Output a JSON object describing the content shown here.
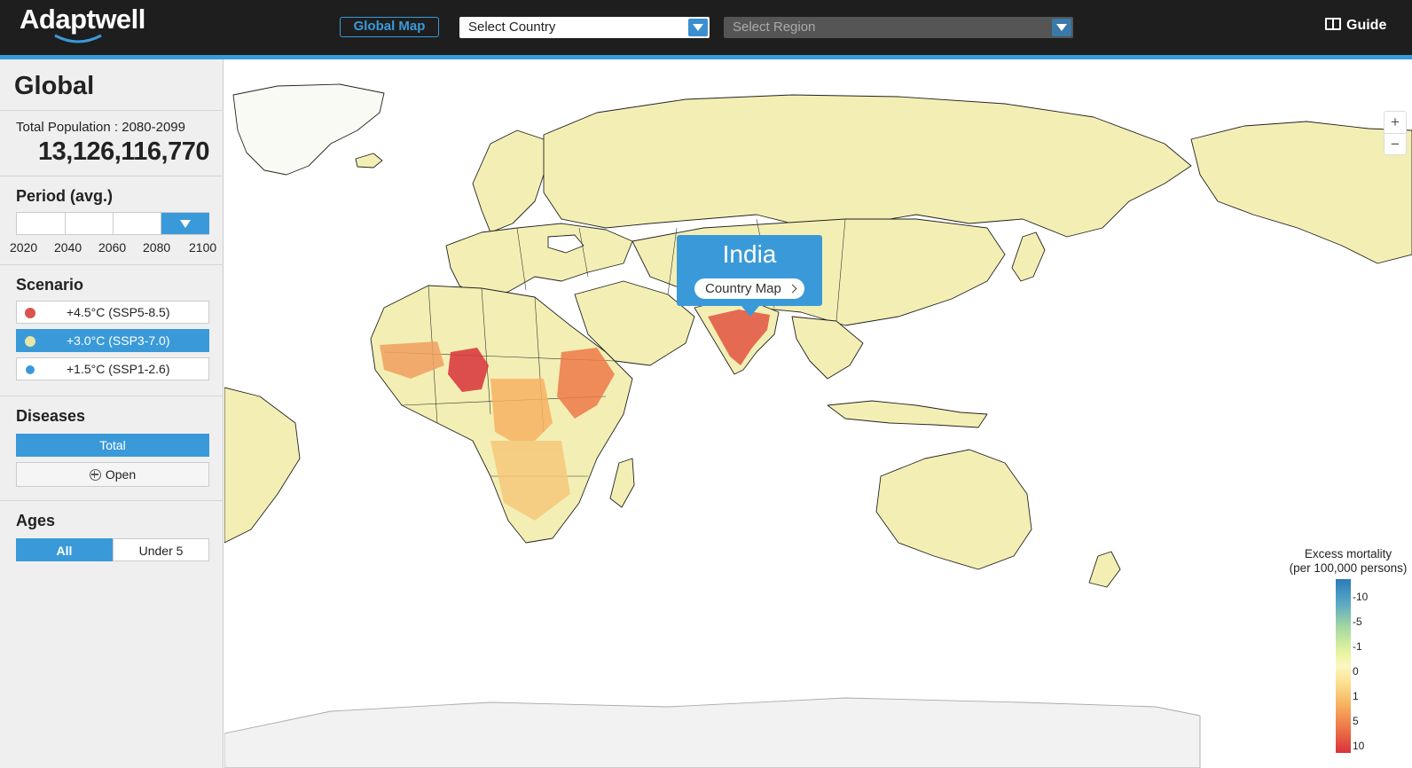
{
  "header": {
    "logo": "Adaptwell",
    "global_map_label": "Global Map",
    "country_select": {
      "value": "Select Country"
    },
    "region_select": {
      "value": "Select Region"
    },
    "guide_label": "Guide"
  },
  "sidebar": {
    "title": "Global",
    "population": {
      "label": "Total Population : 2080-2099",
      "value": "13,126,116,770"
    },
    "period": {
      "heading": "Period (avg.)",
      "ticks": [
        "2020",
        "2040",
        "2060",
        "2080",
        "2100"
      ],
      "selected": "2080-2100"
    },
    "scenario": {
      "heading": "Scenario",
      "options": [
        {
          "label": "+4.5°C (SSP5-8.5)",
          "color": "#d9534f",
          "active": false
        },
        {
          "label": "+3.0°C (SSP3-7.0)",
          "color": "#e6e6a6",
          "active": true
        },
        {
          "label": "+1.5°C (SSP1-2.6)",
          "color": "#3a9ad9",
          "active": false
        }
      ]
    },
    "diseases": {
      "heading": "Diseases",
      "total_label": "Total",
      "open_label": "Open"
    },
    "ages": {
      "heading": "Ages",
      "options": [
        "All",
        "Under 5"
      ],
      "selected": "All"
    }
  },
  "map": {
    "tooltip": {
      "country": "India",
      "button_label": "Country Map"
    },
    "zoom": {
      "in": "+",
      "out": "−"
    },
    "legend": {
      "title_line1": "Excess mortality",
      "title_line2": "(per 100,000 persons)",
      "ticks": [
        "-10",
        "-5",
        "-1",
        "0",
        "1",
        "5",
        "10"
      ],
      "colors": [
        "#2b7bb9",
        "#a6d9a0",
        "#fbf7c0",
        "#f7b362",
        "#d9323a"
      ]
    },
    "colors": {
      "land": "#f3efb4",
      "border": "#222222",
      "hotspot": "#e0543f",
      "ocean": "#ffffff"
    }
  }
}
